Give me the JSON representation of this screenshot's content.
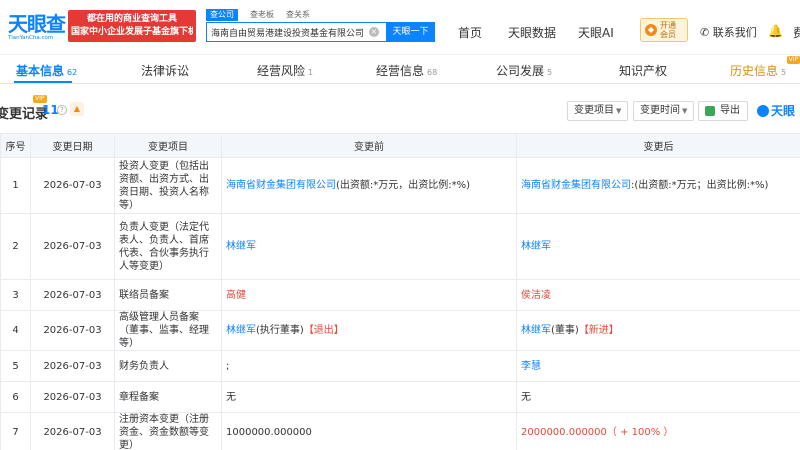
{
  "header": {
    "logo_text": "天眼查",
    "logo_sub": "TianYanCha.com",
    "banner_line1": "都在用的商业查询工具",
    "banner_line2": "国家中小企业发展子基金旗下机构",
    "search_tabs": [
      "查公司",
      "查老板",
      "查关系"
    ],
    "search_value": "海南自由贸易港建设投资基金有限公司",
    "search_button": "天眼一下",
    "nav": [
      "首页",
      "天眼数据",
      "天眼AI"
    ],
    "vip_line1": "开通",
    "vip_line2": "会员",
    "contact": "联系我们",
    "cut_text": "费"
  },
  "tabs": [
    {
      "label": "基本信息",
      "count": "62"
    },
    {
      "label": "法律诉讼",
      "count": ""
    },
    {
      "label": "经营风险",
      "count": "1"
    },
    {
      "label": "经营信息",
      "count": "68"
    },
    {
      "label": "公司发展",
      "count": "5"
    },
    {
      "label": "知识产权",
      "count": ""
    },
    {
      "label": "历史信息",
      "count": "5"
    }
  ],
  "vip_badge": "VIP",
  "section": {
    "title": "变更记录",
    "count": "11",
    "filter_item": "变更项目",
    "filter_time": "变更时间",
    "export": "导出",
    "brand": "天眼"
  },
  "table": {
    "headers": [
      "序号",
      "变更日期",
      "变更项目",
      "变更前",
      "变更后"
    ],
    "rows": [
      {
        "no": "1",
        "date": "2026-07-03",
        "item": "投资人变更（包括出资额、出资方式、出资日期、投资人名称等）",
        "before": "海南省财金集团有限公司",
        "before_extra": "(出资额:*万元，出资比例:*%)",
        "after": "海南省财金集团有限公司",
        "after_extra": ":(出资额:*万元；出资比例:*%)"
      },
      {
        "no": "2",
        "date": "2026-07-03",
        "item": "负责人变更（法定代表人、负责人、首席代表、合伙事务执行人等变更）",
        "before": "林继军",
        "before_extra": "",
        "after": "林继军",
        "after_extra": ""
      },
      {
        "no": "3",
        "date": "2026-07-03",
        "item": "联络员备案",
        "before": "高健",
        "before_extra": "",
        "after": "侯洁凌",
        "after_extra": ""
      },
      {
        "no": "4",
        "date": "2026-07-03",
        "item": "高级管理人员备案（董事、监事、经理等）",
        "before": "林继军",
        "before_extra": "(执行董事)",
        "before_tag": "【退出】",
        "after": "林继军",
        "after_extra": "(董事)",
        "after_tag": "【新进】"
      },
      {
        "no": "5",
        "date": "2026-07-03",
        "item": "财务负责人",
        "before": ";",
        "before_extra": "",
        "after": "李慧",
        "after_extra": ""
      },
      {
        "no": "6",
        "date": "2026-07-03",
        "item": "章程备案",
        "before": "无",
        "before_extra": "",
        "after": "无",
        "after_extra": ""
      },
      {
        "no": "7",
        "date": "2026-07-03",
        "item": "注册资本变更（注册资金、资金数额等变更）",
        "before": "1000000.000000",
        "before_extra": "",
        "after": "2000000.000000",
        "after_extra": "（ + 100% ）"
      }
    ]
  }
}
